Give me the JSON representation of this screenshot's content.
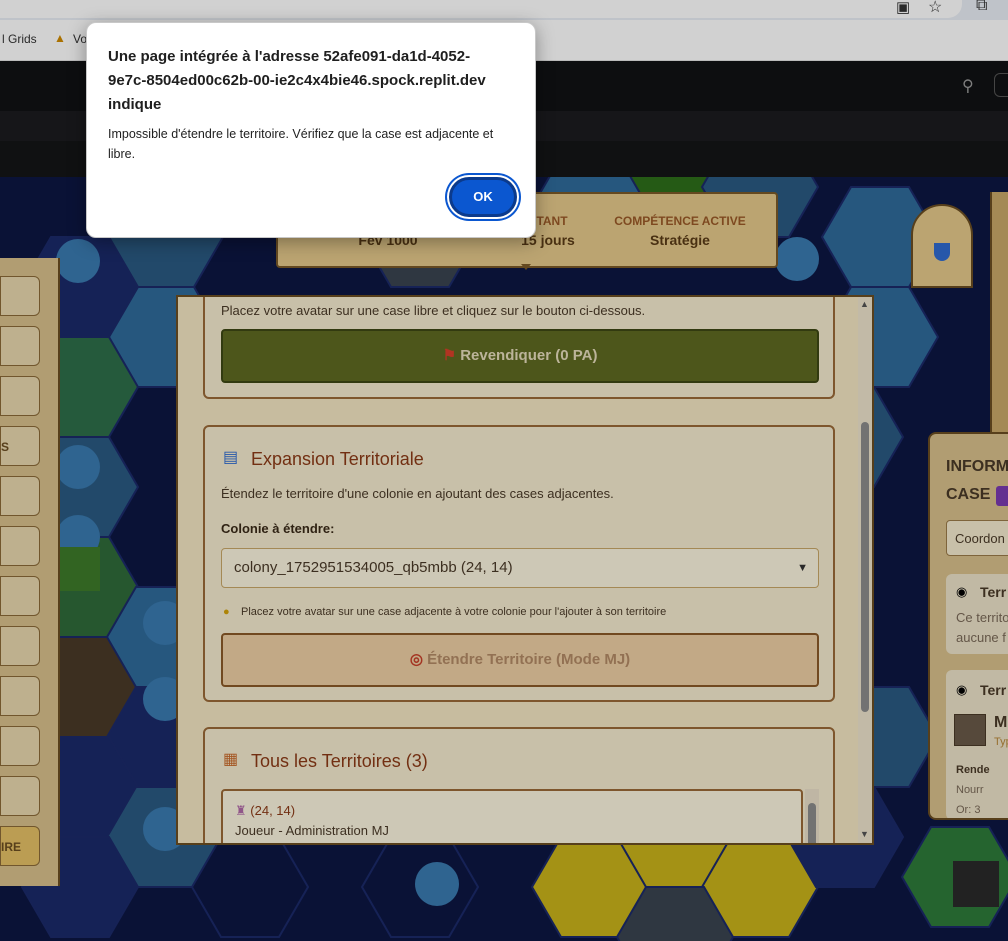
{
  "browser": {
    "bookmarks": [
      {
        "label": "l Grids"
      },
      {
        "label": "Vo"
      }
    ],
    "colors": {
      "chrome": "#e9eef6",
      "header": "#111214"
    }
  },
  "game": {
    "stats": [
      {
        "label": "",
        "value": "Fév 1000"
      },
      {
        "label": "STANT",
        "value": "15 jours"
      },
      {
        "label": "COMPÉTENCE ACTIVE",
        "value": "Stratégie"
      }
    ],
    "left_panel": {
      "buttons": [
        "",
        "",
        "",
        "S",
        "",
        "",
        "",
        "",
        "",
        "",
        "",
        "IRE"
      ]
    },
    "right_panel": {
      "title": "INFORM",
      "title2": "CASE",
      "coord_label": "Coordon",
      "territory_label": "Terr",
      "territory_text": "Ce territo",
      "territory_text2": "aucune f",
      "territory2_label": "Terr",
      "item_initial": "M",
      "item_sub": "Typ",
      "rows": [
        "Rende",
        "Nourr",
        "Or: 3"
      ]
    },
    "modal": {
      "claim": {
        "hint": "Placez votre avatar sur une case libre et cliquez sur le bouton ci-dessous.",
        "button": "Revendiquer (0 PA)",
        "button_icon": "flag-icon"
      },
      "expansion": {
        "title": "Expansion Territoriale",
        "title_icon": "map-icon",
        "description": "Étendez le territoire d'une colonie en ajoutant des cases adjacentes.",
        "select_label": "Colonie à étendre:",
        "select_value": "colony_1752951534005_qb5mbb (24, 14)",
        "tip": "Placez votre avatar sur une case adjacente à votre colonie pour l'ajouter à son territoire",
        "tip_icon": "lightbulb-icon",
        "button": "Étendre Territoire (Mode MJ)",
        "button_icon": "target-icon"
      },
      "territories": {
        "title": "Tous les Territoires (3)",
        "title_icon": "clipboard-icon",
        "items": [
          {
            "coords": "(24, 14)",
            "owner": "Joueur - Administration MJ"
          }
        ]
      }
    }
  },
  "dialog": {
    "title": "Une page intégrée à l'adresse 52afe091-da1d-4052-9e7c-8504ed00c62b-00-ie2c4x4bie46.spock.replit.dev indique",
    "message": "Impossible d'étendre le territoire. Vérifiez que la case est adjacente et libre.",
    "ok_label": "OK",
    "accent": "#0b57d0"
  }
}
